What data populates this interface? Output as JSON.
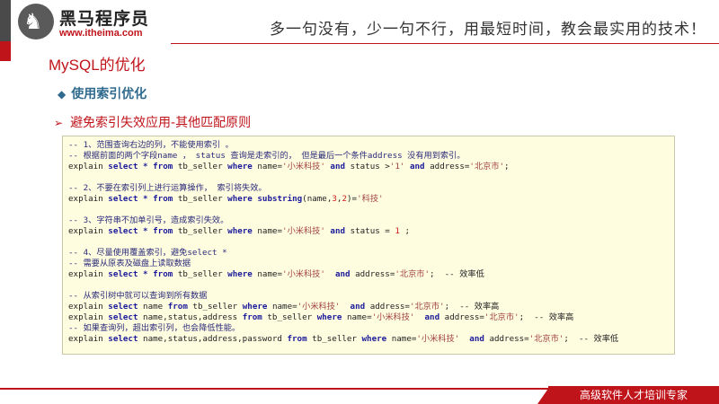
{
  "header": {
    "logo_title": "黑马程序员",
    "logo_url": "www.itheima.com",
    "slogan": "多一句没有，少一句不行，用最短时间，教会最实用的技术！"
  },
  "page_title": "MySQL的优化",
  "section_title": "使用索引优化",
  "sub_title": "避免索引失效应用-其他匹配原则",
  "code": {
    "l1": "-- 1、范围查询右边的列，不能使用索引 。",
    "l2": "-- 根据前面的两个字段name ， status 查询是走索引的， 但是最后一个条件address 没有用到索引。",
    "l3a": "explain",
    "l3b": "select",
    "l3c": "*",
    "l3d": "from",
    "l3e": "tb_seller",
    "l3f": "where",
    "l3g": "name=",
    "l3h": "'小米科技'",
    "l3i": "and",
    "l3j": "status >",
    "l3k": "'1'",
    "l3l": "and",
    "l3m": "address=",
    "l3n": "'北京市'",
    "l3o": ";",
    "l4": "-- 2、不要在索引列上进行运算操作， 索引将失效。",
    "l5a": "explain",
    "l5b": "select",
    "l5c": "*",
    "l5d": "from",
    "l5e": "tb_seller",
    "l5f": "where",
    "l5g": "substring",
    "l5h": "(name,",
    "l5i": "3",
    "l5j": ",",
    "l5k": "2",
    "l5l": ")=",
    "l5m": "'科技'",
    "l6": "-- 3、字符串不加单引号，造成索引失效。",
    "l7a": "explain",
    "l7b": "select",
    "l7c": "*",
    "l7d": "from",
    "l7e": "tb_seller",
    "l7f": "where",
    "l7g": "name=",
    "l7h": "'小米科技'",
    "l7i": "and",
    "l7j": "status =",
    "l7k": "1",
    "l7l": ";",
    "l8": "-- 4、尽量使用覆盖索引，避免select *",
    "l9": "-- 需要从原表及磁盘上读取数据",
    "l10a": "explain",
    "l10b": "select",
    "l10c": "*",
    "l10d": "from",
    "l10e": "tb_seller",
    "l10f": "where",
    "l10g": "name=",
    "l10h": "'小米科技'",
    "l10i": "and",
    "l10j": "address=",
    "l10k": "'北京市'",
    "l10l": ";  -- 效率低",
    "l11": "-- 从索引树中就可以查询到所有数据",
    "l12a": "explain",
    "l12b": "select",
    "l12c": "name",
    "l12d": "from",
    "l12e": "tb_seller",
    "l12f": "where",
    "l12g": "name=",
    "l12h": "'小米科技'",
    "l12i": "and",
    "l12j": "address=",
    "l12k": "'北京市'",
    "l12l": ";  -- 效率高",
    "l13a": "explain",
    "l13b": "select",
    "l13c": "name,status,address",
    "l13d": "from",
    "l13e": "tb_seller",
    "l13f": "where",
    "l13g": "name=",
    "l13h": "'小米科技'",
    "l13i": "and",
    "l13j": "address=",
    "l13k": "'北京市'",
    "l13l": ";  -- 效率高",
    "l14": "-- 如果查询列，超出索引列，也会降低性能。",
    "l15a": "explain",
    "l15b": "select",
    "l15c": "name,status,address,password",
    "l15d": "from",
    "l15e": "tb_seller",
    "l15f": "where",
    "l15g": "name=",
    "l15h": "'小米科技'",
    "l15i": "and",
    "l15j": "address=",
    "l15k": "'北京市'",
    "l15l": ";  -- 效率低"
  },
  "footer": {
    "text": "高级软件人才培训专家"
  },
  "colors": {
    "brand_red": "#c0141b",
    "section_blue": "#2f6a8e",
    "code_bg": "#fffde0"
  }
}
